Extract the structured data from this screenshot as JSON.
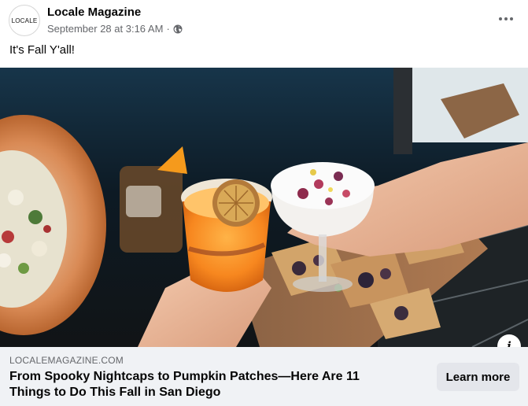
{
  "post": {
    "avatar_text": "LOCALE",
    "page_name": "Locale Magazine",
    "timestamp": "September 28 at 3:16 AM",
    "separator": "·",
    "audience_icon": "globe-icon",
    "more_icon": "more-horizontal-icon",
    "text": "It's Fall Y'all!"
  },
  "image": {
    "description_icon": "info-icon",
    "info_label": "i"
  },
  "link_card": {
    "domain": "LOCALEMAGAZINE.COM",
    "title": "From Spooky Nightcaps to Pumpkin Patches—Here Are 11 Things to Do This Fall in San Diego",
    "cta_label": "Learn more"
  },
  "colors": {
    "card_background": "#f0f2f5",
    "button_background": "#e4e6eb",
    "secondary_text": "#65676b",
    "primary_text": "#050505"
  }
}
